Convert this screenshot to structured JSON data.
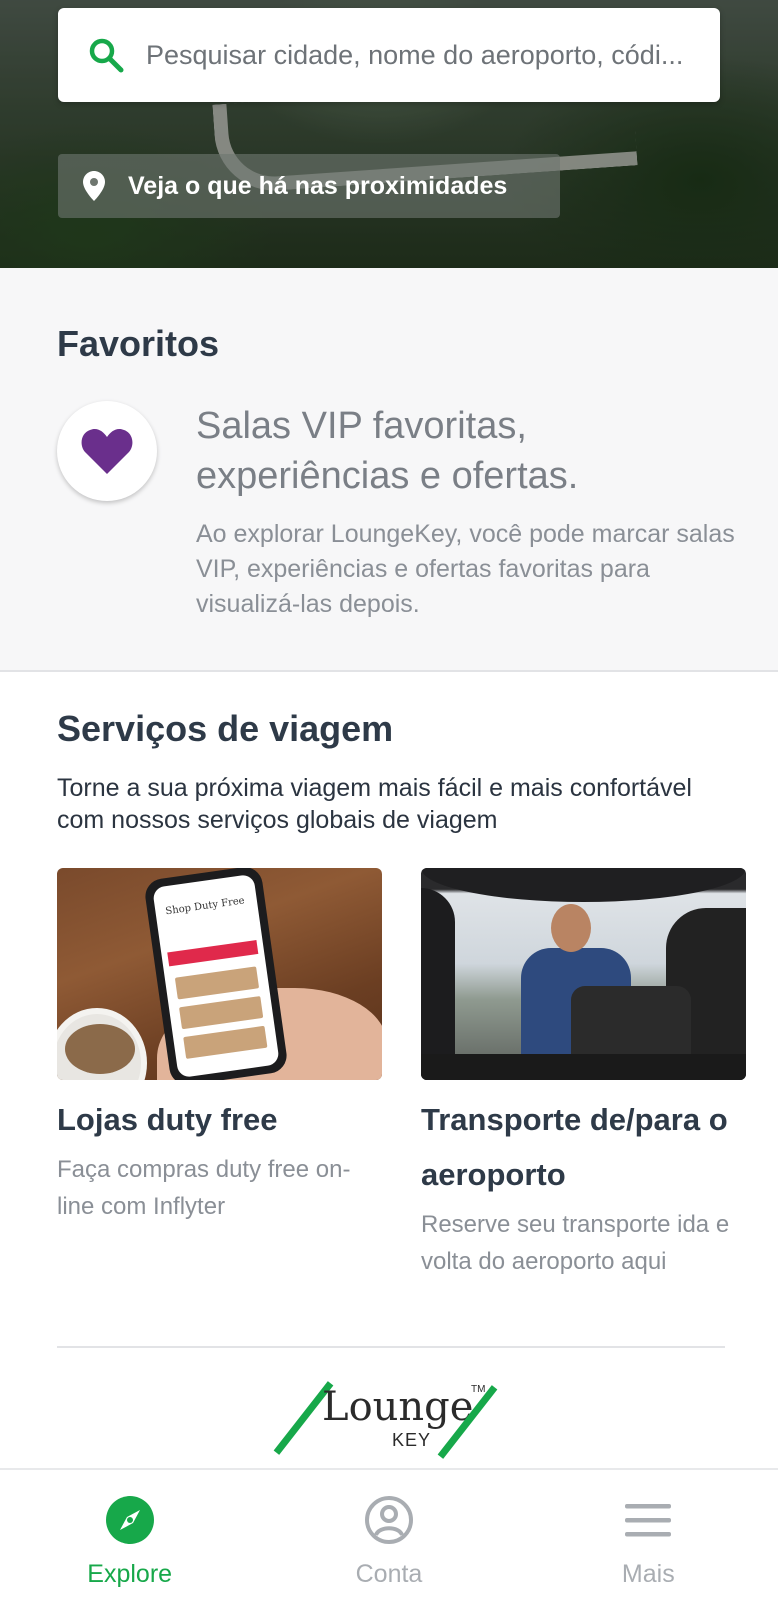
{
  "search": {
    "placeholder": "Pesquisar cidade, nome do aeroporto, códi...",
    "icon": "search-icon"
  },
  "nearby": {
    "label": "Veja o que há nas proximidades",
    "icon": "pin-icon"
  },
  "favorites": {
    "title": "Favoritos",
    "heading": "Salas VIP favoritas, experiências e ofertas.",
    "description": "Ao explorar LoungeKey, você pode marcar salas VIP, experiências e ofertas favoritas para visualizá-las depois.",
    "icon": "heart-icon",
    "icon_color": "#6a2f8c"
  },
  "services": {
    "title": "Serviços de viagem",
    "subtitle": "Torne a sua próxima viagem mais fácil e mais confortável com nossos serviços globais de viagem",
    "cards": [
      {
        "title": "Lojas duty free",
        "description": "Faça compras duty free on-line com Inflyter",
        "image_text": "Shop Duty Free"
      },
      {
        "title": "Transporte de/para o aeroporto",
        "description": "Reserve seu transporte ida e volta do aeroporto aqui"
      }
    ]
  },
  "logo": {
    "word": "Lounge",
    "sub": "KEY",
    "tm": "TM",
    "accent": "#17a84a"
  },
  "nav": {
    "items": [
      {
        "label": "Explore",
        "icon": "compass-icon",
        "active": true
      },
      {
        "label": "Conta",
        "icon": "account-icon",
        "active": false
      },
      {
        "label": "Mais",
        "icon": "menu-icon",
        "active": false
      }
    ],
    "active_color": "#17a84a",
    "inactive_color": "#a9adb2"
  }
}
